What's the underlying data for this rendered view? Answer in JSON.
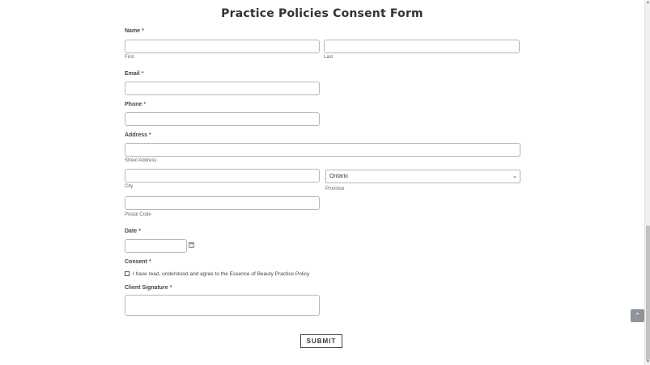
{
  "form": {
    "title": "Practice Policies Consent Form",
    "name": {
      "label": "Name",
      "required": "*",
      "first_sublabel": "First",
      "last_sublabel": "Last"
    },
    "email": {
      "label": "Email",
      "required": "*"
    },
    "phone": {
      "label": "Phone",
      "required": "*"
    },
    "address": {
      "label": "Address",
      "required": "*",
      "street_sublabel": "Street Address",
      "city_sublabel": "City",
      "province_value": "Ontario",
      "province_sublabel": "Province",
      "postal_sublabel": "Postal Code"
    },
    "date": {
      "label": "Date",
      "required": "*"
    },
    "consent": {
      "label": "Consent",
      "required": "*",
      "checkbox_text": "I have read, understood and agree to the Essence of Beauty Practice Policy"
    },
    "signature": {
      "label": "Client Signature",
      "required": "*"
    },
    "submit_label": "SUBMIT"
  },
  "icons": {
    "calendar": "calendar-icon",
    "select_chevron": "chevron-down-icon",
    "back_to_top": "chevron-up-icon"
  }
}
